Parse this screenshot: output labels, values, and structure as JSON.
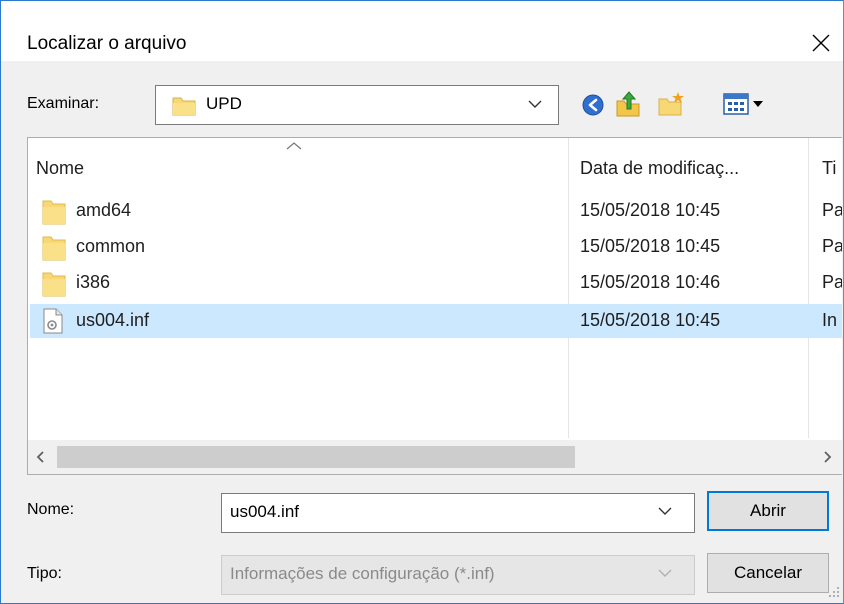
{
  "window": {
    "title": "Localizar o arquivo"
  },
  "toolbar": {
    "lookin_label": "Examinar:",
    "lookin_value": "UPD",
    "icons": [
      "back-icon",
      "up-folder-icon",
      "new-folder-icon",
      "view-menu-icon"
    ]
  },
  "list": {
    "columns": [
      "Nome",
      "Data de modificaç...",
      "Ti"
    ],
    "sorted_column": "Nome",
    "rows": [
      {
        "name": "amd64",
        "date": "15/05/2018 10:45",
        "type": "Pa",
        "icon": "folder-icon",
        "selected": false
      },
      {
        "name": "common",
        "date": "15/05/2018 10:45",
        "type": "Pa",
        "icon": "folder-icon",
        "selected": false
      },
      {
        "name": "i386",
        "date": "15/05/2018 10:46",
        "type": "Pa",
        "icon": "folder-icon",
        "selected": false
      },
      {
        "name": "us004.inf",
        "date": "15/05/2018 10:45",
        "type": "In",
        "icon": "inf-file-icon",
        "selected": true
      }
    ]
  },
  "filename": {
    "label": "Nome:",
    "value": "us004.inf"
  },
  "filetype": {
    "label": "Tipo:",
    "value": "Informações de configuração (*.inf)"
  },
  "buttons": {
    "open": "Abrir",
    "cancel": "Cancelar"
  },
  "colors": {
    "selection": "#cce8ff",
    "accent": "#0078d7",
    "folder": "#f8d775"
  }
}
